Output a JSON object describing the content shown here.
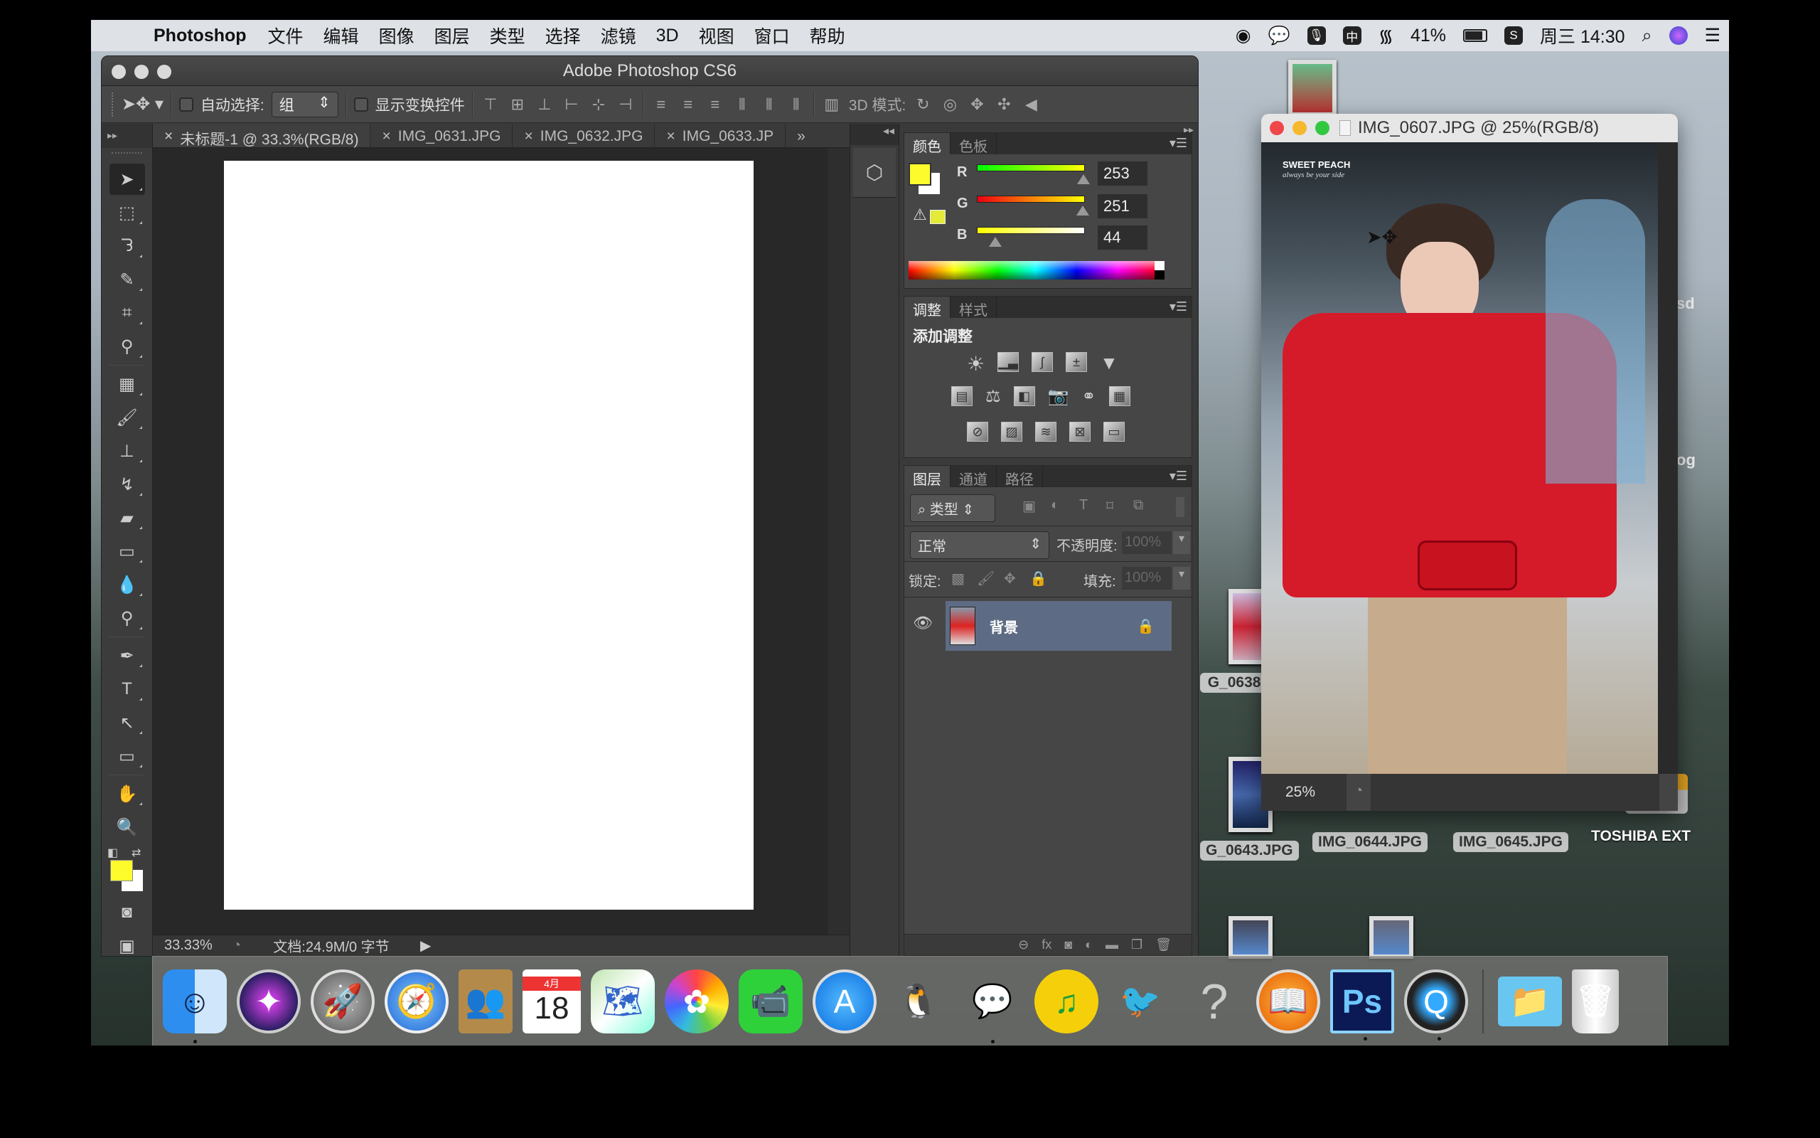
{
  "menubar": {
    "app": "Photoshop",
    "items": [
      "文件",
      "编辑",
      "图像",
      "图层",
      "类型",
      "选择",
      "滤镜",
      "3D",
      "视图",
      "窗口",
      "帮助"
    ],
    "status": {
      "battery": "41%",
      "clock": "周三 14:30",
      "ime": "中"
    }
  },
  "ps_window": {
    "title": "Adobe Photoshop CS6",
    "options": {
      "auto_select_label": "自动选择:",
      "auto_select_value": "组",
      "show_transform_label": "显示变换控件",
      "mode_3d_label": "3D 模式:"
    },
    "tabs": [
      {
        "label": "未标题-1 @ 33.3%(RGB/8)",
        "active": true
      },
      {
        "label": "IMG_0631.JPG",
        "active": false
      },
      {
        "label": "IMG_0632.JPG",
        "active": false
      },
      {
        "label": "IMG_0633.JP",
        "active": false
      }
    ],
    "tabs_overflow": "»",
    "status": {
      "zoom": "33.33%",
      "doc": "文档:24.9M/0 字节"
    },
    "tools": [
      "move",
      "marquee",
      "lasso",
      "quick-select",
      "crop",
      "eyedropper",
      "healing",
      "brush",
      "stamp",
      "history-brush",
      "eraser",
      "gradient",
      "blur",
      "dodge",
      "pen",
      "type",
      "path-select",
      "shape",
      "hand",
      "zoom"
    ],
    "foreground": "#fdfb2c",
    "background": "#ffffff"
  },
  "color_panel": {
    "tabs": [
      "颜色",
      "色板"
    ],
    "active_tab": "颜色",
    "channels": [
      {
        "label": "R",
        "value": "253",
        "fraction": 0.99
      },
      {
        "label": "G",
        "value": "251",
        "fraction": 0.98
      },
      {
        "label": "B",
        "value": "44",
        "fraction": 0.17
      }
    ]
  },
  "adjust_panel": {
    "tabs": [
      "调整",
      "样式"
    ],
    "active_tab": "调整",
    "heading": "添加调整"
  },
  "layers_panel": {
    "tabs": [
      "图层",
      "通道",
      "路径"
    ],
    "active_tab": "图层",
    "filter_label": "类型",
    "blend_mode": "正常",
    "opacity_label": "不透明度:",
    "opacity_value": "100%",
    "lock_label": "锁定:",
    "fill_label": "填充:",
    "fill_value": "100%",
    "layers": [
      {
        "name": "背景",
        "visible": true,
        "locked": true
      }
    ]
  },
  "image_window": {
    "title": "IMG_0607.JPG @ 25%(RGB/8)",
    "zoom": "25%",
    "watermark_title": "SWEET PEACH",
    "watermark_sub": "always be your side"
  },
  "desktop": {
    "labels": [
      "G_0638.",
      "G_0643.JPG",
      "IMG_0644.JPG",
      "IMG_0645.JPG",
      "TOSHIBA EXT"
    ],
    "edge_labels": [
      "sd",
      "og"
    ]
  },
  "dock": {
    "apps": [
      "Finder",
      "Siri",
      "Launchpad",
      "Safari",
      "Contacts",
      "Calendar",
      "Maps",
      "Photos",
      "FaceTime",
      "App Store",
      "QQ",
      "WeChat",
      "QQ Music",
      "Migration",
      "Unknown",
      "iBooks",
      "Photoshop",
      "QuickTime",
      "Downloads",
      "Trash"
    ],
    "calendar_month": "4月",
    "calendar_day": "18"
  }
}
